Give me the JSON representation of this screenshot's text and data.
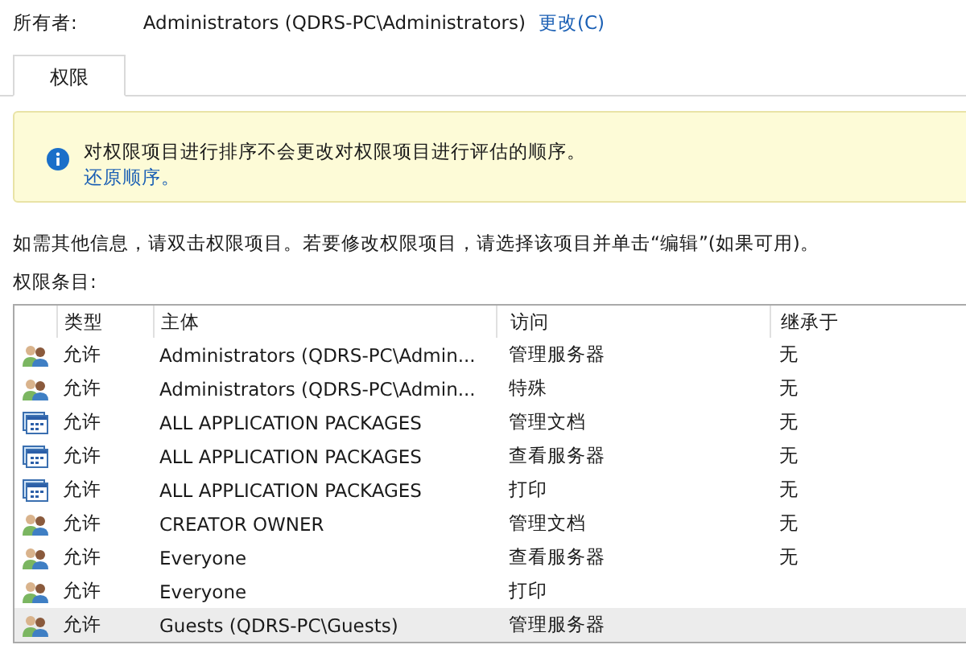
{
  "owner": {
    "label": "所有者:",
    "value": "Administrators (QDRS-PC\\Administrators)",
    "change_link": "更改(C)"
  },
  "tabs": [
    {
      "label": "权限",
      "selected": true
    }
  ],
  "info_banner": {
    "text": "对权限项目进行排序不会更改对权限项目进行评估的顺序。",
    "link": "还原顺序。"
  },
  "instruction": "如需其他信息，请双击权限项目。若要修改权限项目，请选择该项目并单击“编辑”(如果可用)。",
  "table": {
    "label": "权限条目:",
    "columns": [
      "类型",
      "主体",
      "访问",
      "继承于"
    ],
    "rows": [
      {
        "kind": "group",
        "type": "允许",
        "principal": "Administrators (QDRS-PC\\Admin...",
        "access": "管理服务器",
        "inherited": "无",
        "selected": false
      },
      {
        "kind": "group",
        "type": "允许",
        "principal": "Administrators (QDRS-PC\\Admin...",
        "access": "特殊",
        "inherited": "无",
        "selected": false
      },
      {
        "kind": "package",
        "type": "允许",
        "principal": "ALL APPLICATION PACKAGES",
        "access": "管理文档",
        "inherited": "无",
        "selected": false
      },
      {
        "kind": "package",
        "type": "允许",
        "principal": "ALL APPLICATION PACKAGES",
        "access": "查看服务器",
        "inherited": "无",
        "selected": false
      },
      {
        "kind": "package",
        "type": "允许",
        "principal": "ALL APPLICATION PACKAGES",
        "access": "打印",
        "inherited": "无",
        "selected": false
      },
      {
        "kind": "group",
        "type": "允许",
        "principal": "CREATOR OWNER",
        "access": "管理文档",
        "inherited": "无",
        "selected": false
      },
      {
        "kind": "group",
        "type": "允许",
        "principal": "Everyone",
        "access": "查看服务器",
        "inherited": "无",
        "selected": false
      },
      {
        "kind": "group",
        "type": "允许",
        "principal": "Everyone",
        "access": "打印",
        "selected": false
      },
      {
        "kind": "group",
        "type": "允许",
        "principal": "Guests (QDRS-PC\\Guests)",
        "access": "管理服务器",
        "selected": true
      }
    ]
  }
}
